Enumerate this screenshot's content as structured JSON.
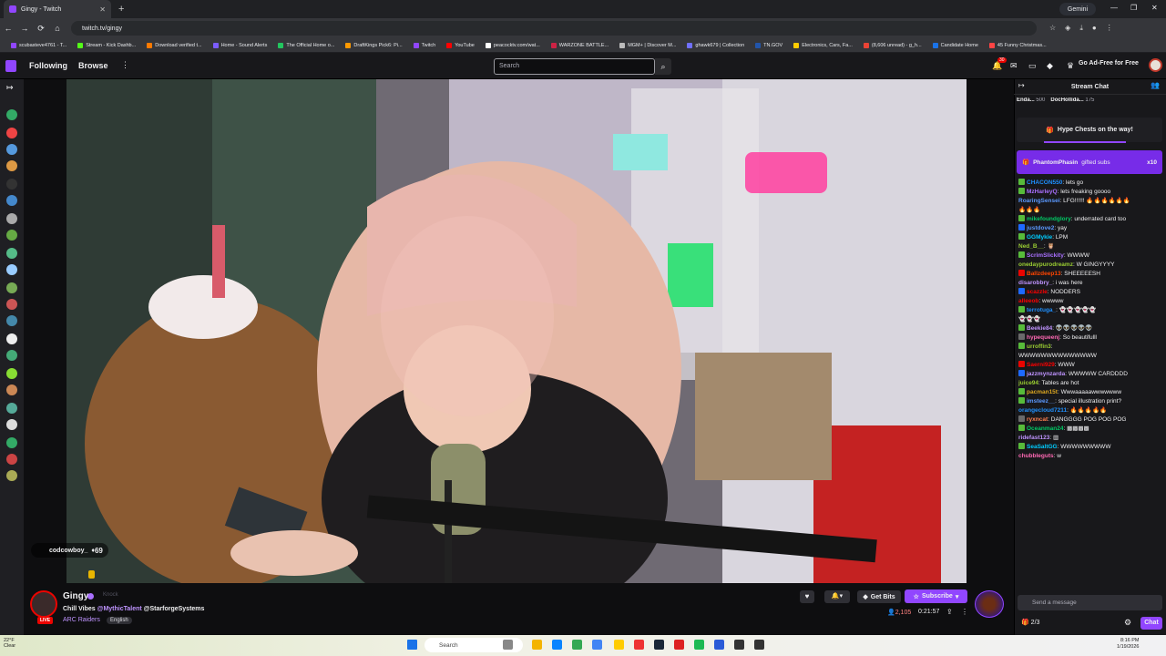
{
  "browser": {
    "tab_title": "Gingy - Twitch",
    "gemini_label": "Gemini",
    "url": "twitch.tv/gingy",
    "bookmarks": [
      "scubasteve4761 - T...",
      "Stream - Kick Dashb...",
      "Download verified t...",
      "Home - Sound Alerts",
      "The Official Home o...",
      "DraftKings Pick6: Pi...",
      "Twitch",
      "YouTube",
      "peacocktv.com/wat...",
      "WARZONE BATTLE...",
      "MGM+ | Discover M...",
      "ghawk679 | Collection",
      "TN.GOV",
      "Electronics, Cars, Fa...",
      "(8,606 unread) - g_h...",
      "Candidate Home",
      "45 Funny Christmas..."
    ]
  },
  "twitch_nav": {
    "following": "Following",
    "browse": "Browse",
    "search_placeholder": "Search",
    "notification_count": "30",
    "ad_free": "Go Ad-Free for Free"
  },
  "video": {
    "overlay_user": "codcowboy_",
    "overlay_count": "69"
  },
  "channel": {
    "name": "Gingy",
    "knock": "Knock",
    "title_prefix": "Chill Vibes",
    "tag1": "@MythicTalent",
    "tag2": "@StarforgeSystems",
    "category": "ARC Raiders",
    "language": "English",
    "live": "LIVE",
    "get_bits": "Get Bits",
    "subscribe": "Subscribe",
    "viewers": "2,105",
    "uptime": "0:21:57"
  },
  "chat": {
    "header": "Stream Chat",
    "leaders": [
      {
        "name": "Enda...",
        "points": "500"
      },
      {
        "name": "DocHollida...",
        "points": "175"
      }
    ],
    "hype_chest": "Hype Chests on the way!",
    "gift_user": "PhantomPhasin",
    "gift_text": "gifted subs",
    "gift_count": "x10",
    "messages": [
      {
        "user": "CHACON550",
        "color": "#1e90ff",
        "badge": "#57bb3a",
        "text": "lets go"
      },
      {
        "user": "MzHarleyQ",
        "color": "#a970ff",
        "badge": "#57bb3a",
        "text": "lets freaking goooo"
      },
      {
        "user": "RoaringSensei",
        "color": "#5b99ff",
        "badge": "",
        "text": "LFG!!!!!! 🔥🔥🔥🔥🔥🔥"
      },
      {
        "user": "",
        "color": "#efeff1",
        "badge": "",
        "text": "🔥🔥🔥"
      },
      {
        "user": "mikefoundglory",
        "color": "#00c864",
        "badge": "#57bb3a",
        "text": "underrated card too"
      },
      {
        "user": "justdove2",
        "color": "#5b99ff",
        "badge": "#1e69ff",
        "text": "yay"
      },
      {
        "user": "GGMykie",
        "color": "#00ccff",
        "badge": "#57bb3a",
        "text": "LPM"
      },
      {
        "user": "Ned_B__",
        "color": "#9acd32",
        "badge": "",
        "text": "🦉"
      },
      {
        "user": "ScrimSlickity",
        "color": "#a970ff",
        "badge": "#57bb3a",
        "text": "WWWW"
      },
      {
        "user": "onedaypurodreamz",
        "color": "#9acd32",
        "badge": "",
        "text": "W GINGYYYY"
      },
      {
        "user": "Ballzdeep13",
        "color": "#ff4500",
        "badge": "#eb0400",
        "text": "SHEEEEESH"
      },
      {
        "user": "disarobbry_",
        "color": "#bf94ff",
        "badge": "",
        "text": "i was here"
      },
      {
        "user": "scazzle",
        "color": "#ff0000",
        "badge": "#1e69ff",
        "text": "NODDERS"
      },
      {
        "user": "alleeob",
        "color": "#ff0000",
        "badge": "",
        "text": "wwwww"
      },
      {
        "user": "terrotuga_",
        "color": "#1e90ff",
        "badge": "#57bb3a",
        "text": "👻👻👻👻👻"
      },
      {
        "user": "",
        "color": "#efeff1",
        "badge": "",
        "text": "👻👻👻"
      },
      {
        "user": "Beekie84",
        "color": "#bf94ff",
        "badge": "#57bb3a",
        "text": "👽👽👽👽👽"
      },
      {
        "user": "hypequeenj",
        "color": "#ff69b4",
        "badge": "#6a6a6a",
        "text": "So beautifulll"
      },
      {
        "user": "urroffin3",
        "color": "#9acd32",
        "badge": "#57bb3a",
        "text": ""
      },
      {
        "user": "",
        "color": "#efeff1",
        "badge": "",
        "text": "WWWWWWWWWWWWWW"
      },
      {
        "user": "Saerni929",
        "color": "#ff0000",
        "badge": "#eb0400",
        "text": "WWW"
      },
      {
        "user": "jazzmynzarda",
        "color": "#bf94ff",
        "badge": "#1e69ff",
        "text": "WWWWW CARDDDD"
      },
      {
        "user": "juice94",
        "color": "#9acd32",
        "badge": "",
        "text": "Tables are hot"
      },
      {
        "user": "pacman15t",
        "color": "#daa520",
        "badge": "#57bb3a",
        "text": "Wwwaaaaawwwwwww"
      },
      {
        "user": "imsteez__",
        "color": "#5b99ff",
        "badge": "#57bb3a",
        "text": "special illustration print?"
      },
      {
        "user": "orangecloud7211",
        "color": "#1e90ff",
        "badge": "",
        "text": "🔥🔥🔥🔥🔥"
      },
      {
        "user": "ryxncat",
        "color": "#ff7f50",
        "badge": "#6a6a6a",
        "text": "DANGGGG POG POG POG"
      },
      {
        "user": "Oceanman24",
        "color": "#00c864",
        "badge": "#57bb3a",
        "text": "▩▩▩▩"
      },
      {
        "user": "ridefast123",
        "color": "#bf94ff",
        "badge": "",
        "text": "▥"
      },
      {
        "user": "SeaSaltGG",
        "color": "#00ccff",
        "badge": "#57bb3a",
        "text": "WWWWWWWWW"
      },
      {
        "user": "chubbleguts",
        "color": "#ff69b4",
        "badge": "",
        "text": "w"
      }
    ],
    "input_placeholder": "Send a message",
    "points": "2/3",
    "chat_button": "Chat"
  },
  "taskbar": {
    "temp": "22°F",
    "weather": "Clear",
    "search": "Search",
    "time": "8:16 PM",
    "date": "1/19/2026"
  },
  "colors": {
    "twitch_purple": "#9146ff",
    "live_red": "#eb0400"
  }
}
